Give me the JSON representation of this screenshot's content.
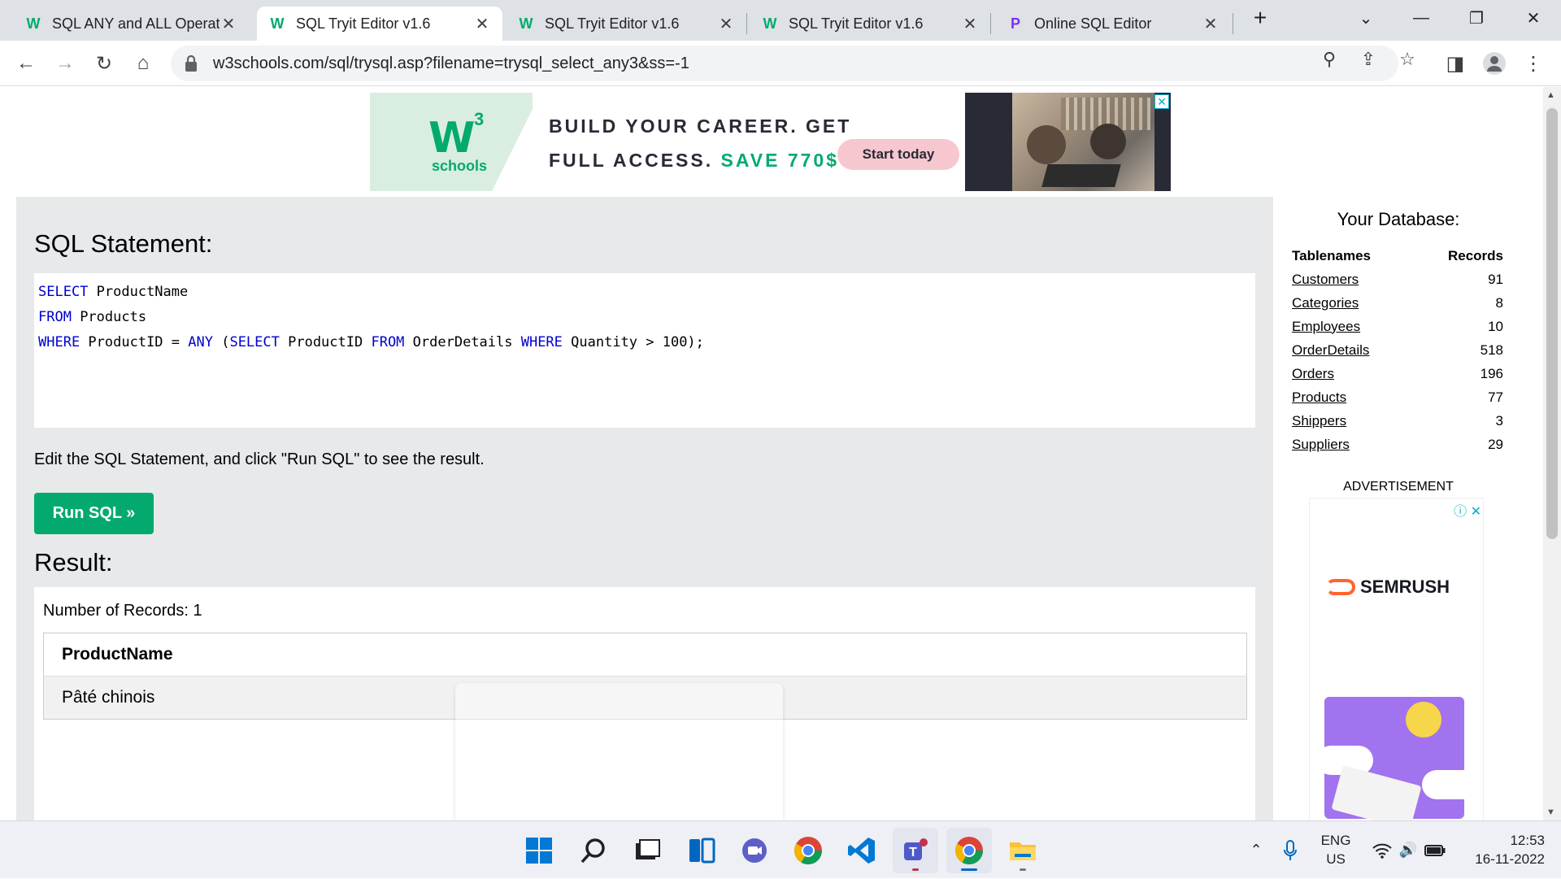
{
  "browser": {
    "tabs": [
      {
        "title": "SQL ANY and ALL Operato",
        "active": false
      },
      {
        "title": "SQL Tryit Editor v1.6",
        "active": true
      },
      {
        "title": "SQL Tryit Editor v1.6",
        "active": false
      },
      {
        "title": "SQL Tryit Editor v1.6",
        "active": false
      },
      {
        "title": "Online SQL Editor",
        "active": false
      }
    ],
    "url": "w3schools.com/sql/trysql.asp?filename=trysql_select_any3&ss=-1"
  },
  "ad_banner": {
    "logo_mark": "W",
    "logo_sup": "3",
    "logo_text": "schools",
    "line1": "BUILD YOUR CAREER. GET",
    "line2_prefix": "FULL ACCESS.",
    "line2_highlight": "SAVE 770$",
    "cta": "Start today"
  },
  "editor": {
    "heading": "SQL Statement:",
    "code_lines": [
      [
        {
          "t": "SELECT",
          "kw": true
        },
        {
          "t": " ProductName"
        }
      ],
      [
        {
          "t": "FROM",
          "kw": true
        },
        {
          "t": " Products"
        }
      ],
      [
        {
          "t": "WHERE",
          "kw": true
        },
        {
          "t": " ProductID = "
        },
        {
          "t": "ANY",
          "kw": true
        },
        {
          "t": " ("
        },
        {
          "t": "SELECT",
          "kw": true
        },
        {
          "t": " ProductID "
        },
        {
          "t": "FROM",
          "kw": true
        },
        {
          "t": " OrderDetails "
        },
        {
          "t": "WHERE",
          "kw": true
        },
        {
          "t": " Quantity > 100);"
        }
      ]
    ],
    "instruction": "Edit the SQL Statement, and click \"Run SQL\" to see the result.",
    "run_button": "Run SQL »"
  },
  "result": {
    "heading": "Result:",
    "count_text": "Number of Records: 1",
    "columns": [
      "ProductName"
    ],
    "rows": [
      [
        "Pâté chinois"
      ]
    ]
  },
  "database": {
    "title": "Your Database:",
    "col_tables": "Tablenames",
    "col_records": "Records",
    "tables": [
      {
        "name": "Customers",
        "records": "91"
      },
      {
        "name": "Categories",
        "records": "8"
      },
      {
        "name": "Employees",
        "records": "10"
      },
      {
        "name": "OrderDetails",
        "records": "518"
      },
      {
        "name": "Orders",
        "records": "196"
      },
      {
        "name": "Products",
        "records": "77"
      },
      {
        "name": "Shippers",
        "records": "3"
      },
      {
        "name": "Suppliers",
        "records": "29"
      }
    ]
  },
  "sidebar_ad": {
    "label": "ADVERTISEMENT",
    "brand": "SEMRUSH"
  },
  "taskbar": {
    "apps": [
      "windows-start",
      "search",
      "task-view",
      "widgets",
      "teams-chat",
      "chrome",
      "vscode",
      "teams",
      "chrome",
      "file-explorer"
    ],
    "lang_line1": "ENG",
    "lang_line2": "US",
    "time": "12:53",
    "date": "16-11-2022"
  }
}
